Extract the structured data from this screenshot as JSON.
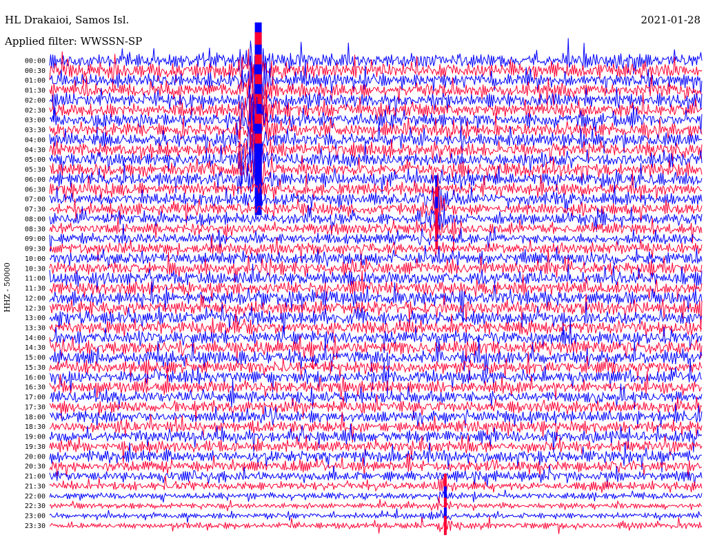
{
  "header": {
    "station": "HL Drakaioi, Samos Isl.",
    "filter": "Applied filter: WWSSN-SP",
    "date": "2021-01-28",
    "channel": "HHZ - 50000"
  },
  "colors": {
    "trace_a": "#0000ff",
    "trace_b": "#ff0033",
    "background": "#ffffff",
    "text": "#000000"
  },
  "chart_data": {
    "type": "line",
    "title": "HL Drakaioi, Samos Isl.",
    "subtitle": "Applied filter: WWSSN-SP",
    "ylabel": "HHZ - 50000",
    "xlabel": "",
    "grid": false,
    "legend": "none",
    "row_ticks": [
      "00:00",
      "00:30",
      "01:00",
      "01:30",
      "02:00",
      "02:30",
      "03:00",
      "03:30",
      "04:00",
      "04:30",
      "05:00",
      "05:30",
      "06:00",
      "06:30",
      "07:00",
      "07:30",
      "08:00",
      "08:30",
      "09:00",
      "09:30",
      "10:00",
      "10:30",
      "11:00",
      "11:30",
      "12:00",
      "12:30",
      "13:00",
      "13:30",
      "14:00",
      "14:30",
      "15:00",
      "15:30",
      "16:00",
      "16:30",
      "17:00",
      "17:30",
      "18:00",
      "18:30",
      "19:00",
      "19:30",
      "20:00",
      "20:30",
      "21:00",
      "21:30",
      "22:00",
      "22:30",
      "23:00",
      "23:30"
    ],
    "series": [
      {
        "color": "#0000ff",
        "rows": [
          0,
          2,
          4,
          6,
          8,
          10,
          12,
          14,
          16,
          18,
          20,
          22,
          24,
          26,
          28,
          30,
          32,
          34,
          36,
          38,
          40,
          42,
          44,
          46
        ]
      },
      {
        "color": "#ff0033",
        "rows": [
          1,
          3,
          5,
          7,
          9,
          11,
          13,
          15,
          17,
          19,
          21,
          23,
          25,
          27,
          29,
          31,
          33,
          35,
          37,
          39,
          41,
          43,
          45,
          47
        ]
      }
    ],
    "row_amplitude": [
      1.6,
      1.6,
      1.5,
      1.5,
      1.5,
      1.5,
      1.5,
      1.5,
      1.5,
      1.5,
      1.5,
      1.5,
      1.5,
      1.4,
      1.4,
      1.3,
      1.3,
      1.2,
      1.2,
      1.3,
      1.4,
      1.4,
      1.5,
      1.5,
      1.5,
      1.5,
      1.5,
      1.5,
      1.5,
      1.5,
      1.5,
      1.4,
      1.4,
      1.3,
      1.3,
      1.3,
      1.3,
      1.3,
      1.3,
      1.3,
      1.3,
      1.2,
      1.1,
      0.9,
      0.7,
      0.6,
      0.6,
      0.7
    ],
    "events": [
      {
        "row_start": 0,
        "row_end": 12,
        "minute": 9.5,
        "strength": 3.5
      },
      {
        "row_start": 14,
        "row_end": 17,
        "minute": 17.8,
        "strength": 2.5
      },
      {
        "row_start": 43,
        "row_end": 47,
        "minute": 18.2,
        "strength": 2.0
      }
    ],
    "xlim_minutes": [
      0,
      30
    ]
  }
}
